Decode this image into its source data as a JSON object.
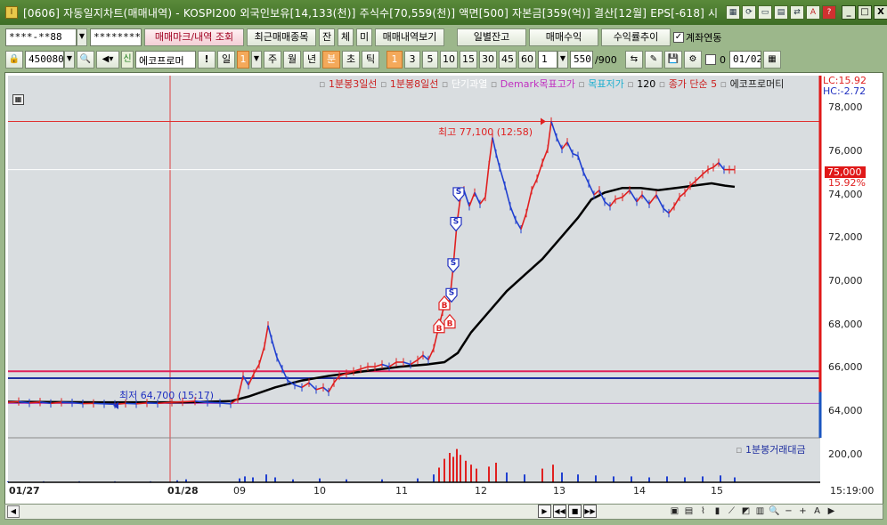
{
  "window": {
    "title": "[0606] 자동일지차트(매매내역) - KOSPI200 외국인보유[14,133(천)] 주식수[70,559(천)] 액면[500] 자본금[359(억)] 결산[12월] EPS[-618] 시",
    "app_icon": "I",
    "title_tool_icons": [
      "grid-icon",
      "refresh-icon",
      "window-icon",
      "layout-icon",
      "link-icon",
      "font-icon",
      "help-icon"
    ],
    "title_tool_glyphs": [
      "▦",
      "⟳",
      "▭",
      "▤",
      "⇄",
      "A",
      "?"
    ],
    "controls": [
      "_",
      "□",
      "X"
    ]
  },
  "toolbar1": {
    "account": "****-**88",
    "password": "********",
    "trade_mark_button": "매매마크/내역 조회",
    "recent_trades_button": "최근매매종목",
    "small_buttons": [
      "잔",
      "체",
      "미"
    ],
    "trade_history_button": "매매내역보기",
    "daily_balance_button": "일별잔고",
    "trade_profit_button": "매매수익",
    "return_trend_button": "수익률추이",
    "account_link_checkbox": "계좌연동",
    "account_link_checked": true
  },
  "toolbar2": {
    "stock_code": "450080",
    "new_badge": "신",
    "stock_name": "에코프로머",
    "exclaim": "!",
    "period_label": "일",
    "period_value": "1",
    "periods": [
      "주",
      "월",
      "년",
      "분",
      "초",
      "틱"
    ],
    "selected_period": "분",
    "intervals": [
      "1",
      "3",
      "5",
      "10",
      "15",
      "30",
      "45",
      "60"
    ],
    "selected_interval": "1",
    "count_value": "1",
    "bars_display": "550",
    "bars_total": "/900",
    "date_value": "01/02",
    "date_checkbox_checked": false,
    "date_checkbox_label": "0"
  },
  "chart_data": {
    "type": "line",
    "legend": [
      {
        "label": "1분봉3일선",
        "color": "#cc2020"
      },
      {
        "label": "1분봉8일선",
        "color": "#cc2020"
      },
      {
        "label": "단기과열",
        "color": "#ffffff"
      },
      {
        "label": "Demark목표고가",
        "color": "#c030c0"
      },
      {
        "label": "목표저가",
        "color": "#20b0d0"
      },
      {
        "label": "120",
        "color": "#000000"
      },
      {
        "label": "종가 단순 5",
        "color": "#cc2020"
      },
      {
        "label": "에코프로머티",
        "color": "#222222"
      }
    ],
    "price_ticks": [
      "78,000",
      "76,000",
      "74,000",
      "72,000",
      "70,000",
      "68,000",
      "66,000",
      "64,000"
    ],
    "volume_tick": "200,00",
    "volume_legend": "1분봉거래대금",
    "x_labels": [
      "01/27",
      "01/28",
      "09",
      "10",
      "11",
      "12",
      "13",
      "14",
      "15",
      "15:19:00"
    ],
    "high_annotation": "최고 77,100 (12:58)",
    "low_annotation": "최저 64,700 (15:17)",
    "current_price": "75,000",
    "current_pct": "15.92%",
    "lc_label": "LC:15.92",
    "hc_label": "HC:-2.72",
    "ylim": [
      63300,
      79100
    ],
    "price_series": [
      [
        0,
        64850
      ],
      [
        12,
        64880
      ],
      [
        24,
        64820
      ],
      [
        36,
        64860
      ],
      [
        48,
        64800
      ],
      [
        60,
        64850
      ],
      [
        72,
        64830
      ],
      [
        84,
        64790
      ],
      [
        96,
        64800
      ],
      [
        108,
        64780
      ],
      [
        120,
        64760
      ],
      [
        132,
        64800
      ],
      [
        144,
        64780
      ],
      [
        156,
        64820
      ],
      [
        168,
        64800
      ],
      [
        184,
        64850
      ],
      [
        196,
        64870
      ],
      [
        210,
        64900
      ],
      [
        224,
        64850
      ],
      [
        238,
        64820
      ],
      [
        250,
        64780
      ],
      [
        258,
        65000
      ],
      [
        264,
        66000
      ],
      [
        270,
        65600
      ],
      [
        276,
        66100
      ],
      [
        282,
        66500
      ],
      [
        288,
        67300
      ],
      [
        292,
        68200
      ],
      [
        296,
        67600
      ],
      [
        302,
        66800
      ],
      [
        308,
        66300
      ],
      [
        314,
        65800
      ],
      [
        322,
        65600
      ],
      [
        330,
        65500
      ],
      [
        338,
        65700
      ],
      [
        346,
        65400
      ],
      [
        354,
        65500
      ],
      [
        360,
        65300
      ],
      [
        366,
        65700
      ],
      [
        372,
        66000
      ],
      [
        380,
        66100
      ],
      [
        388,
        66200
      ],
      [
        396,
        66300
      ],
      [
        404,
        66400
      ],
      [
        412,
        66400
      ],
      [
        420,
        66500
      ],
      [
        428,
        66400
      ],
      [
        436,
        66600
      ],
      [
        444,
        66600
      ],
      [
        452,
        66500
      ],
      [
        460,
        66700
      ],
      [
        466,
        66900
      ],
      [
        472,
        66700
      ],
      [
        478,
        67200
      ],
      [
        484,
        68200
      ],
      [
        488,
        68800
      ],
      [
        492,
        69200
      ],
      [
        496,
        69300
      ],
      [
        500,
        70800
      ],
      [
        504,
        72600
      ],
      [
        508,
        73800
      ],
      [
        512,
        74100
      ],
      [
        518,
        73400
      ],
      [
        524,
        74000
      ],
      [
        530,
        73500
      ],
      [
        536,
        73800
      ],
      [
        540,
        75200
      ],
      [
        544,
        76400
      ],
      [
        548,
        75700
      ],
      [
        552,
        75100
      ],
      [
        558,
        74300
      ],
      [
        564,
        73400
      ],
      [
        570,
        72800
      ],
      [
        576,
        72400
      ],
      [
        582,
        73100
      ],
      [
        588,
        74100
      ],
      [
        594,
        74600
      ],
      [
        600,
        75300
      ],
      [
        606,
        75900
      ],
      [
        610,
        77100
      ],
      [
        616,
        76400
      ],
      [
        622,
        75900
      ],
      [
        628,
        76200
      ],
      [
        634,
        75700
      ],
      [
        640,
        75600
      ],
      [
        646,
        74900
      ],
      [
        652,
        74400
      ],
      [
        658,
        73900
      ],
      [
        664,
        74100
      ],
      [
        670,
        73600
      ],
      [
        676,
        73400
      ],
      [
        682,
        73700
      ],
      [
        690,
        73800
      ],
      [
        698,
        74100
      ],
      [
        706,
        73600
      ],
      [
        712,
        73900
      ],
      [
        720,
        73500
      ],
      [
        728,
        73900
      ],
      [
        736,
        73300
      ],
      [
        742,
        73100
      ],
      [
        748,
        73400
      ],
      [
        754,
        73800
      ],
      [
        760,
        74000
      ],
      [
        766,
        74300
      ],
      [
        772,
        74500
      ],
      [
        780,
        74800
      ],
      [
        786,
        75000
      ],
      [
        792,
        75100
      ],
      [
        798,
        75300
      ],
      [
        804,
        75000
      ],
      [
        810,
        75000
      ],
      [
        816,
        75000
      ]
    ],
    "ma120_series": [
      [
        0,
        64870
      ],
      [
        100,
        64850
      ],
      [
        200,
        64850
      ],
      [
        250,
        64900
      ],
      [
        270,
        65100
      ],
      [
        300,
        65500
      ],
      [
        330,
        65800
      ],
      [
        360,
        66000
      ],
      [
        400,
        66200
      ],
      [
        440,
        66400
      ],
      [
        470,
        66500
      ],
      [
        490,
        66600
      ],
      [
        505,
        67000
      ],
      [
        520,
        67900
      ],
      [
        540,
        68800
      ],
      [
        560,
        69700
      ],
      [
        580,
        70400
      ],
      [
        600,
        71100
      ],
      [
        620,
        72000
      ],
      [
        640,
        72900
      ],
      [
        655,
        73700
      ],
      [
        670,
        74000
      ],
      [
        690,
        74200
      ],
      [
        710,
        74200
      ],
      [
        730,
        74100
      ],
      [
        750,
        74200
      ],
      [
        770,
        74300
      ],
      [
        790,
        74400
      ],
      [
        805,
        74300
      ],
      [
        816,
        74250
      ]
    ],
    "buy_markers": [
      [
        484,
        68200
      ],
      [
        496,
        68400
      ],
      [
        490,
        69200
      ]
    ],
    "sell_markers": [
      [
        498,
        69500
      ],
      [
        500,
        70800
      ],
      [
        503,
        72600
      ],
      [
        506,
        73900
      ]
    ],
    "hlines": [
      {
        "value": 77100,
        "color": "#e03030"
      },
      {
        "value": 75000,
        "color": "#ffffff"
      },
      {
        "value": 66200,
        "color": "#e0205a"
      },
      {
        "value": 65900,
        "color": "#2030a0"
      },
      {
        "value": 64800,
        "color": "#b040c0"
      }
    ],
    "volume_series": [
      [
        0,
        1
      ],
      [
        40,
        1
      ],
      [
        80,
        1
      ],
      [
        120,
        1
      ],
      [
        160,
        1
      ],
      [
        190,
        2
      ],
      [
        200,
        3
      ],
      [
        260,
        4
      ],
      [
        266,
        6
      ],
      [
        275,
        5
      ],
      [
        290,
        8
      ],
      [
        300,
        5
      ],
      [
        320,
        3
      ],
      [
        350,
        4
      ],
      [
        380,
        3
      ],
      [
        420,
        3
      ],
      [
        460,
        4
      ],
      [
        478,
        8
      ],
      [
        484,
        15
      ],
      [
        490,
        24
      ],
      [
        496,
        30
      ],
      [
        500,
        26
      ],
      [
        504,
        34
      ],
      [
        508,
        28
      ],
      [
        514,
        22
      ],
      [
        520,
        18
      ],
      [
        526,
        14
      ],
      [
        540,
        16
      ],
      [
        548,
        20
      ],
      [
        560,
        10
      ],
      [
        580,
        8
      ],
      [
        600,
        14
      ],
      [
        612,
        18
      ],
      [
        622,
        10
      ],
      [
        640,
        8
      ],
      [
        660,
        7
      ],
      [
        680,
        6
      ],
      [
        700,
        6
      ],
      [
        720,
        5
      ],
      [
        740,
        6
      ],
      [
        760,
        5
      ],
      [
        780,
        6
      ],
      [
        800,
        7
      ],
      [
        816,
        5
      ]
    ]
  }
}
